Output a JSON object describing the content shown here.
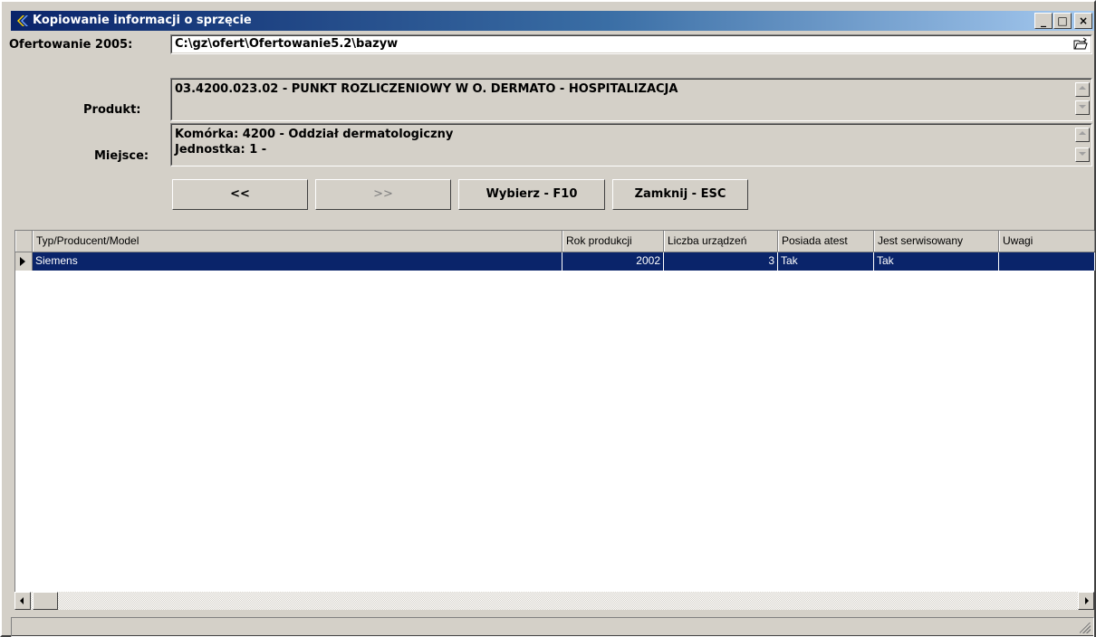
{
  "window": {
    "title": "Kopiowanie informacji o sprzęcie",
    "minimize": "_",
    "maximize": "□",
    "close": "×"
  },
  "form": {
    "ofertowanie_label": "Ofertowanie 2005:",
    "ofertowanie_path": "C:\\gz\\ofert\\Ofertowanie5.2\\bazyw",
    "produkt_label": "Produkt:",
    "produkt_value": "03.4200.023.02 - PUNKT ROZLICZENIOWY W O. DERMATO - HOSPITALIZACJA",
    "miejsce_label": "Miejsce:",
    "miejsce_line1": "Komórka: 4200 - Oddział dermatologiczny",
    "miejsce_line2": "Jednostka: 1 -"
  },
  "buttons": {
    "prev": "<<",
    "next": ">>",
    "select": "Wybierz - F10",
    "close": "Zamknij - ESC"
  },
  "grid": {
    "columns": [
      "Typ/Producent/Model",
      "Rok produkcji",
      "Liczba urządzeń",
      "Posiada atest",
      "Jest serwisowany",
      "Uwagi"
    ],
    "rows": [
      {
        "model": "Siemens",
        "rok": "2002",
        "liczba": "3",
        "atest": "Tak",
        "serwis": "Tak",
        "uwagi": ""
      }
    ]
  },
  "colors": {
    "selection": "#0a246a",
    "face": "#d4d0c8"
  }
}
